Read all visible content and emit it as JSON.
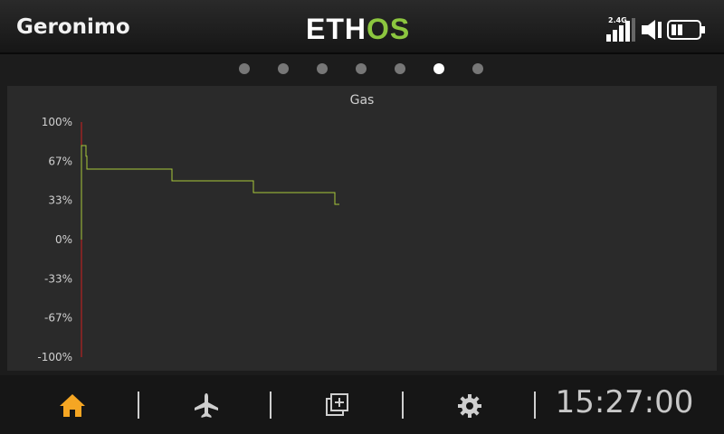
{
  "header": {
    "model_name": "Geronimo",
    "logo_text_a": "ETH",
    "logo_text_b": "OS",
    "band_label": "2.4G"
  },
  "pager": {
    "count": 7,
    "active_index": 5
  },
  "chart_data": {
    "type": "line",
    "title": "Gas",
    "ytick_labels": [
      "100%",
      "67%",
      "33%",
      "0%",
      "-33%",
      "-67%",
      "-100%"
    ],
    "ylim": [
      -100,
      100
    ],
    "series": [
      {
        "color": "#a8c83a",
        "x": [
          0,
          0,
          5,
          5,
          6,
          6,
          9,
          9,
          100,
          100,
          190,
          190,
          280,
          280,
          285
        ],
        "values": [
          0,
          80,
          80,
          71,
          71,
          60,
          60,
          60,
          60,
          50,
          50,
          40,
          40,
          30,
          30
        ]
      }
    ],
    "cursor_color": "#d02020",
    "grid": false
  },
  "footer": {
    "clock": "15:27:00",
    "home_color": "#f5a623"
  }
}
